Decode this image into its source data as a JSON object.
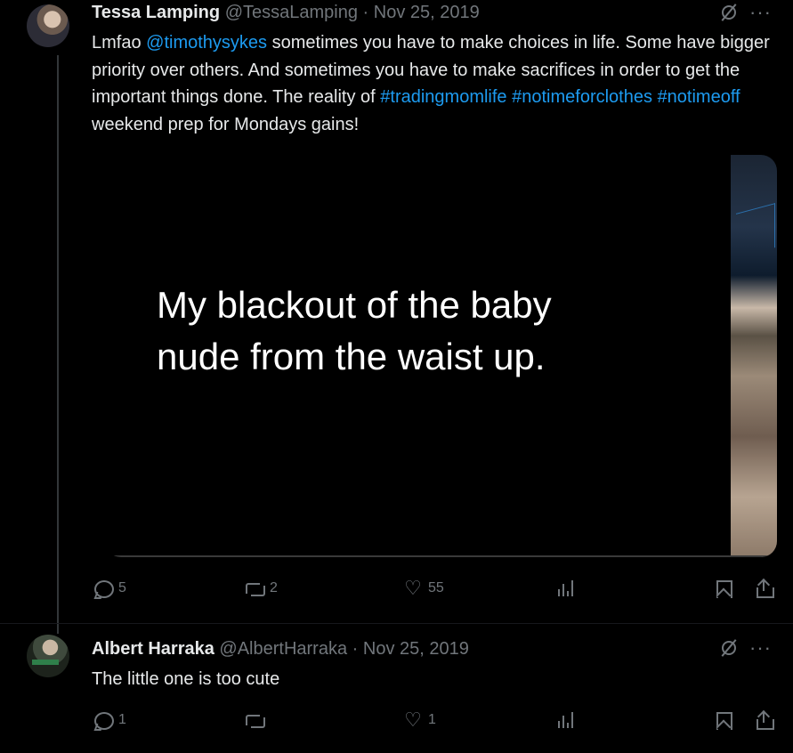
{
  "tweet": {
    "author_name": "Tessa Lamping",
    "author_handle": "@TessaLamping",
    "separator": " · ",
    "date": "Nov 25, 2019",
    "text_parts": [
      {
        "text": "Lmfao ",
        "link": false
      },
      {
        "text": "@timothysykes",
        "link": true
      },
      {
        "text": " sometimes you have to make choices in life. Some have bigger priority over others. And sometimes you have to make sacrifices in order to get the important things done. The reality of ",
        "link": false
      },
      {
        "text": "#tradingmomlife",
        "link": true
      },
      {
        "text": " ",
        "link": false
      },
      {
        "text": "#notimeforclothes",
        "link": true
      },
      {
        "text": " ",
        "link": false
      },
      {
        "text": "#notimeoff",
        "link": true
      },
      {
        "text": " weekend prep for Mondays gains!",
        "link": false
      }
    ],
    "media_caption": "My blackout of the baby nude from the waist up.",
    "media_caption_line1": "My blackout of the baby",
    "media_caption_line2": "nude from the waist up.",
    "stats": {
      "replies": "5",
      "retweets": "2",
      "likes": "55"
    }
  },
  "reply": {
    "author_name": "Albert Harraka",
    "author_handle": "@AlbertHarraka",
    "separator": " · ",
    "date": "Nov 25, 2019",
    "text": "The little one is too cute",
    "stats": {
      "replies": "1",
      "retweets": "",
      "likes": "1"
    }
  },
  "icons": {
    "more": "more-icon",
    "grok": "slash-circle-icon",
    "reply": "reply-icon",
    "retweet": "retweet-icon",
    "like": "heart-icon",
    "views": "views-icon",
    "bookmark": "bookmark-icon",
    "share": "share-icon"
  },
  "colors": {
    "link": "#1d9bf0",
    "muted": "#71767b",
    "background": "#000000",
    "text": "#e7e9ea"
  }
}
